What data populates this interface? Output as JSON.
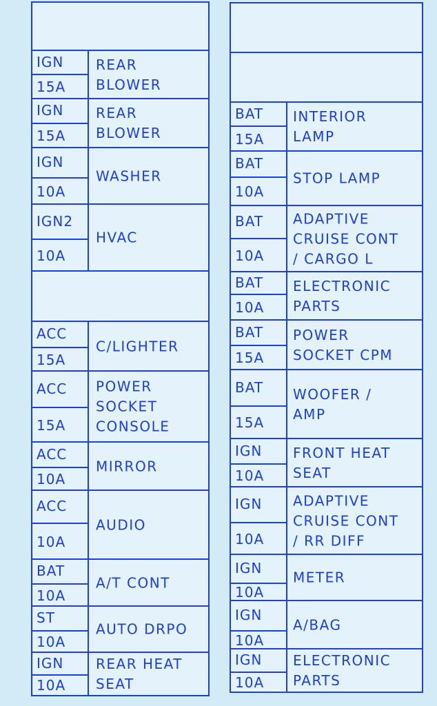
{
  "colors": {
    "line": "#1b3fe0",
    "text": "#1b3fe0",
    "background": "#d3ebf7"
  },
  "left_panel": [
    {
      "type": "blank"
    },
    {
      "source": "IGN",
      "amps": "15A",
      "label": [
        "REAR",
        "BLOWER"
      ]
    },
    {
      "source": "IGN",
      "amps": "15A",
      "label": [
        "REAR",
        "BLOWER"
      ]
    },
    {
      "source": "IGN",
      "amps": "10A",
      "label": [
        "WASHER"
      ]
    },
    {
      "source": "IGN2",
      "amps": "10A",
      "label": [
        "HVAC"
      ]
    },
    {
      "type": "blank"
    },
    {
      "source": "ACC",
      "amps": "15A",
      "label": [
        "C/LIGHTER"
      ]
    },
    {
      "source": "ACC",
      "amps": "15A",
      "label": [
        "POWER",
        "SOCKET",
        "CONSOLE"
      ]
    },
    {
      "source": "ACC",
      "amps": "10A",
      "label": [
        "MIRROR"
      ]
    },
    {
      "source": "ACC",
      "amps": "10A",
      "label": [
        "AUDIO"
      ]
    },
    {
      "source": "BAT",
      "amps": "10A",
      "label": [
        "A/T CONT"
      ]
    },
    {
      "source": "ST",
      "amps": "10A",
      "label": [
        "AUTO DRPO"
      ]
    },
    {
      "source": "IGN",
      "amps": "10A",
      "label": [
        "REAR HEAT",
        "SEAT"
      ]
    }
  ],
  "right_panel": [
    {
      "type": "blank"
    },
    {
      "type": "blank"
    },
    {
      "source": "BAT",
      "amps": "15A",
      "label": [
        "INTERIOR",
        "LAMP"
      ]
    },
    {
      "source": "BAT",
      "amps": "10A",
      "label": [
        "STOP LAMP"
      ]
    },
    {
      "source": "BAT",
      "amps": "10A",
      "label": [
        "ADAPTIVE",
        "CRUISE CONT",
        "/ CARGO L"
      ]
    },
    {
      "source": "BAT",
      "amps": "10A",
      "label": [
        "ELECTRONIC",
        "PARTS"
      ]
    },
    {
      "source": "BAT",
      "amps": "15A",
      "label": [
        "POWER",
        "SOCKET CPM"
      ]
    },
    {
      "source": "BAT",
      "amps": "15A",
      "label": [
        "WOOFER /",
        "AMP"
      ]
    },
    {
      "source": "IGN",
      "amps": "10A",
      "label": [
        "FRONT HEAT",
        "SEAT"
      ]
    },
    {
      "source": "IGN",
      "amps": "10A",
      "label": [
        "ADAPTIVE",
        "CRUISE CONT",
        "/ RR DIFF"
      ]
    },
    {
      "source": "IGN",
      "amps": "10A",
      "label": [
        "METER"
      ]
    },
    {
      "source": "IGN",
      "amps": "10A",
      "label": [
        "A/BAG"
      ]
    },
    {
      "source": "IGN",
      "amps": "10A",
      "label": [
        "ELECTRONIC",
        "PARTS"
      ]
    }
  ]
}
